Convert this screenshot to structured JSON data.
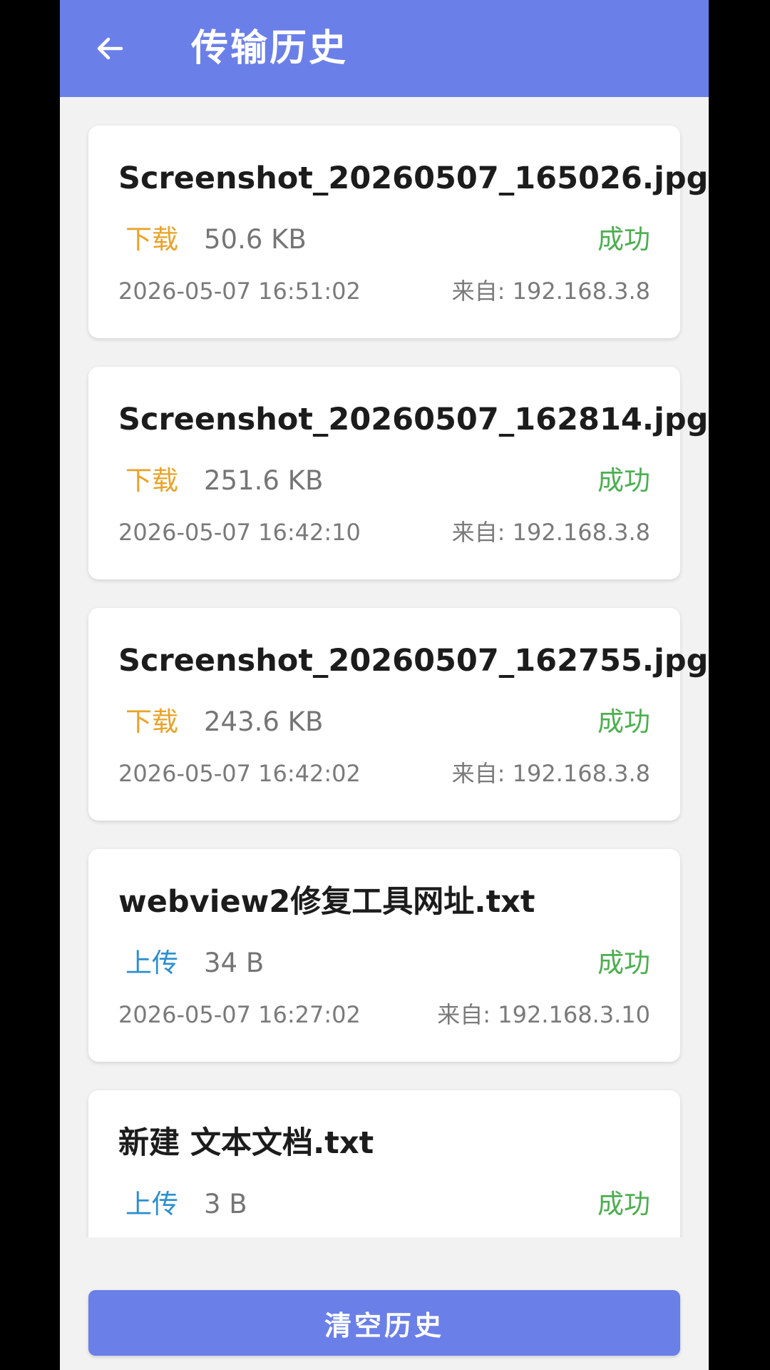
{
  "header": {
    "title": "传输历史",
    "back_icon": "arrow-left-icon",
    "color": "#6b7fe8"
  },
  "transfers": [
    {
      "file_name": "Screenshot_20260507_165026.jpg",
      "direction": "下载",
      "direction_type": "download",
      "size": "50.6 KB",
      "status": "成功",
      "time": "2026-05-07 16:51:02",
      "from": "来自: 192.168.3.8"
    },
    {
      "file_name": "Screenshot_20260507_162814.jpg",
      "direction": "下载",
      "direction_type": "download",
      "size": "251.6 KB",
      "status": "成功",
      "time": "2026-05-07 16:42:10",
      "from": "来自: 192.168.3.8"
    },
    {
      "file_name": "Screenshot_20260507_162755.jpg",
      "direction": "下载",
      "direction_type": "download",
      "size": "243.6 KB",
      "status": "成功",
      "time": "2026-05-07 16:42:02",
      "from": "来自: 192.168.3.8"
    },
    {
      "file_name": "webview2修复工具网址.txt",
      "direction": "上传",
      "direction_type": "upload",
      "size": "34 B",
      "status": "成功",
      "time": "2026-05-07 16:27:02",
      "from": "来自: 192.168.3.10"
    },
    {
      "file_name": "新建 文本文档.txt",
      "direction": "上传",
      "direction_type": "upload",
      "size": "3 B",
      "status": "成功"
    }
  ],
  "footer": {
    "clear_label": "清空历史"
  },
  "colors": {
    "download": "#e9a227",
    "upload": "#2b8fd0",
    "success": "#4caf50"
  }
}
